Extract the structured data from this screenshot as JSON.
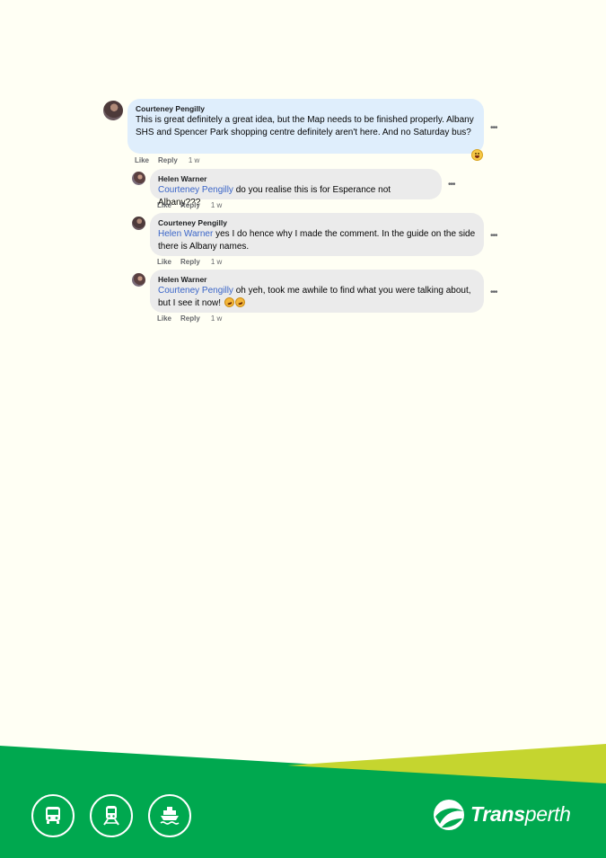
{
  "comments": [
    {
      "author": "Courteney Pengilly",
      "mention": "",
      "text": "This is great definitely a great idea, but the Map needs to be finished properly. Albany SHS and Spencer Park shopping centre definitely aren't here. And no Saturday bus?",
      "like": "Like",
      "reply": "Reply",
      "time": "1 w",
      "reaction": "laugh-reaction"
    },
    {
      "author": "Helen Warner",
      "mention": "Courteney Pengilly",
      "text": " do you realise this is for Esperance not Albany???",
      "like": "Like",
      "reply": "Reply",
      "time": "1 w"
    },
    {
      "author": "Courteney Pengilly",
      "mention": "Helen Warner",
      "text": " yes I do hence why I made the comment. In the guide on the side there is Albany names.",
      "like": "Like",
      "reply": "Reply",
      "time": "1 w"
    },
    {
      "author": "Helen Warner",
      "mention": "Courteney Pengilly",
      "text": " oh yeh, took me awhile to find what you were talking about, but I see it now! ",
      "like": "Like",
      "reply": "Reply",
      "time": "1 w",
      "emojis": [
        "rofl-emoji",
        "rofl-emoji"
      ]
    }
  ],
  "footer": {
    "brand_bold": "Trans",
    "brand_light": "perth",
    "icons": [
      "bus-icon",
      "train-icon",
      "ferry-icon"
    ],
    "colors": {
      "green": "#00a84f",
      "lime": "#c5d52f",
      "white": "#ffffff"
    }
  }
}
